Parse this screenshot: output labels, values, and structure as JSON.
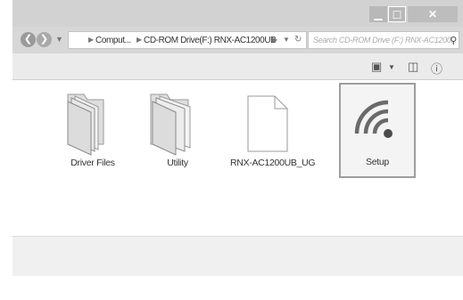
{
  "titlebar": {
    "minimize_glyph": "▁",
    "maximize_glyph": "☐",
    "close_glyph": "✕"
  },
  "navigation": {
    "back_glyph": "❮",
    "forward_glyph": "❯",
    "breadcrumbs": [
      "Comput...",
      "CD-ROM Drive(F:) RNX-AC1200UB"
    ],
    "search_placeholder": "Search CD-ROM Drive (F:) RNX-AC1200..."
  },
  "files": [
    {
      "name": "Driver Files",
      "icon": "folder-icon"
    },
    {
      "name": "Utility",
      "icon": "folder-icon"
    },
    {
      "name": "RNX-AC1200UB_UG",
      "icon": "document-icon"
    },
    {
      "name": "Setup",
      "icon": "wifi-setup-icon",
      "selected": true
    }
  ],
  "colors": {
    "accent_gray": "#9e9e9e",
    "window_chrome": "#d2d2d2"
  }
}
